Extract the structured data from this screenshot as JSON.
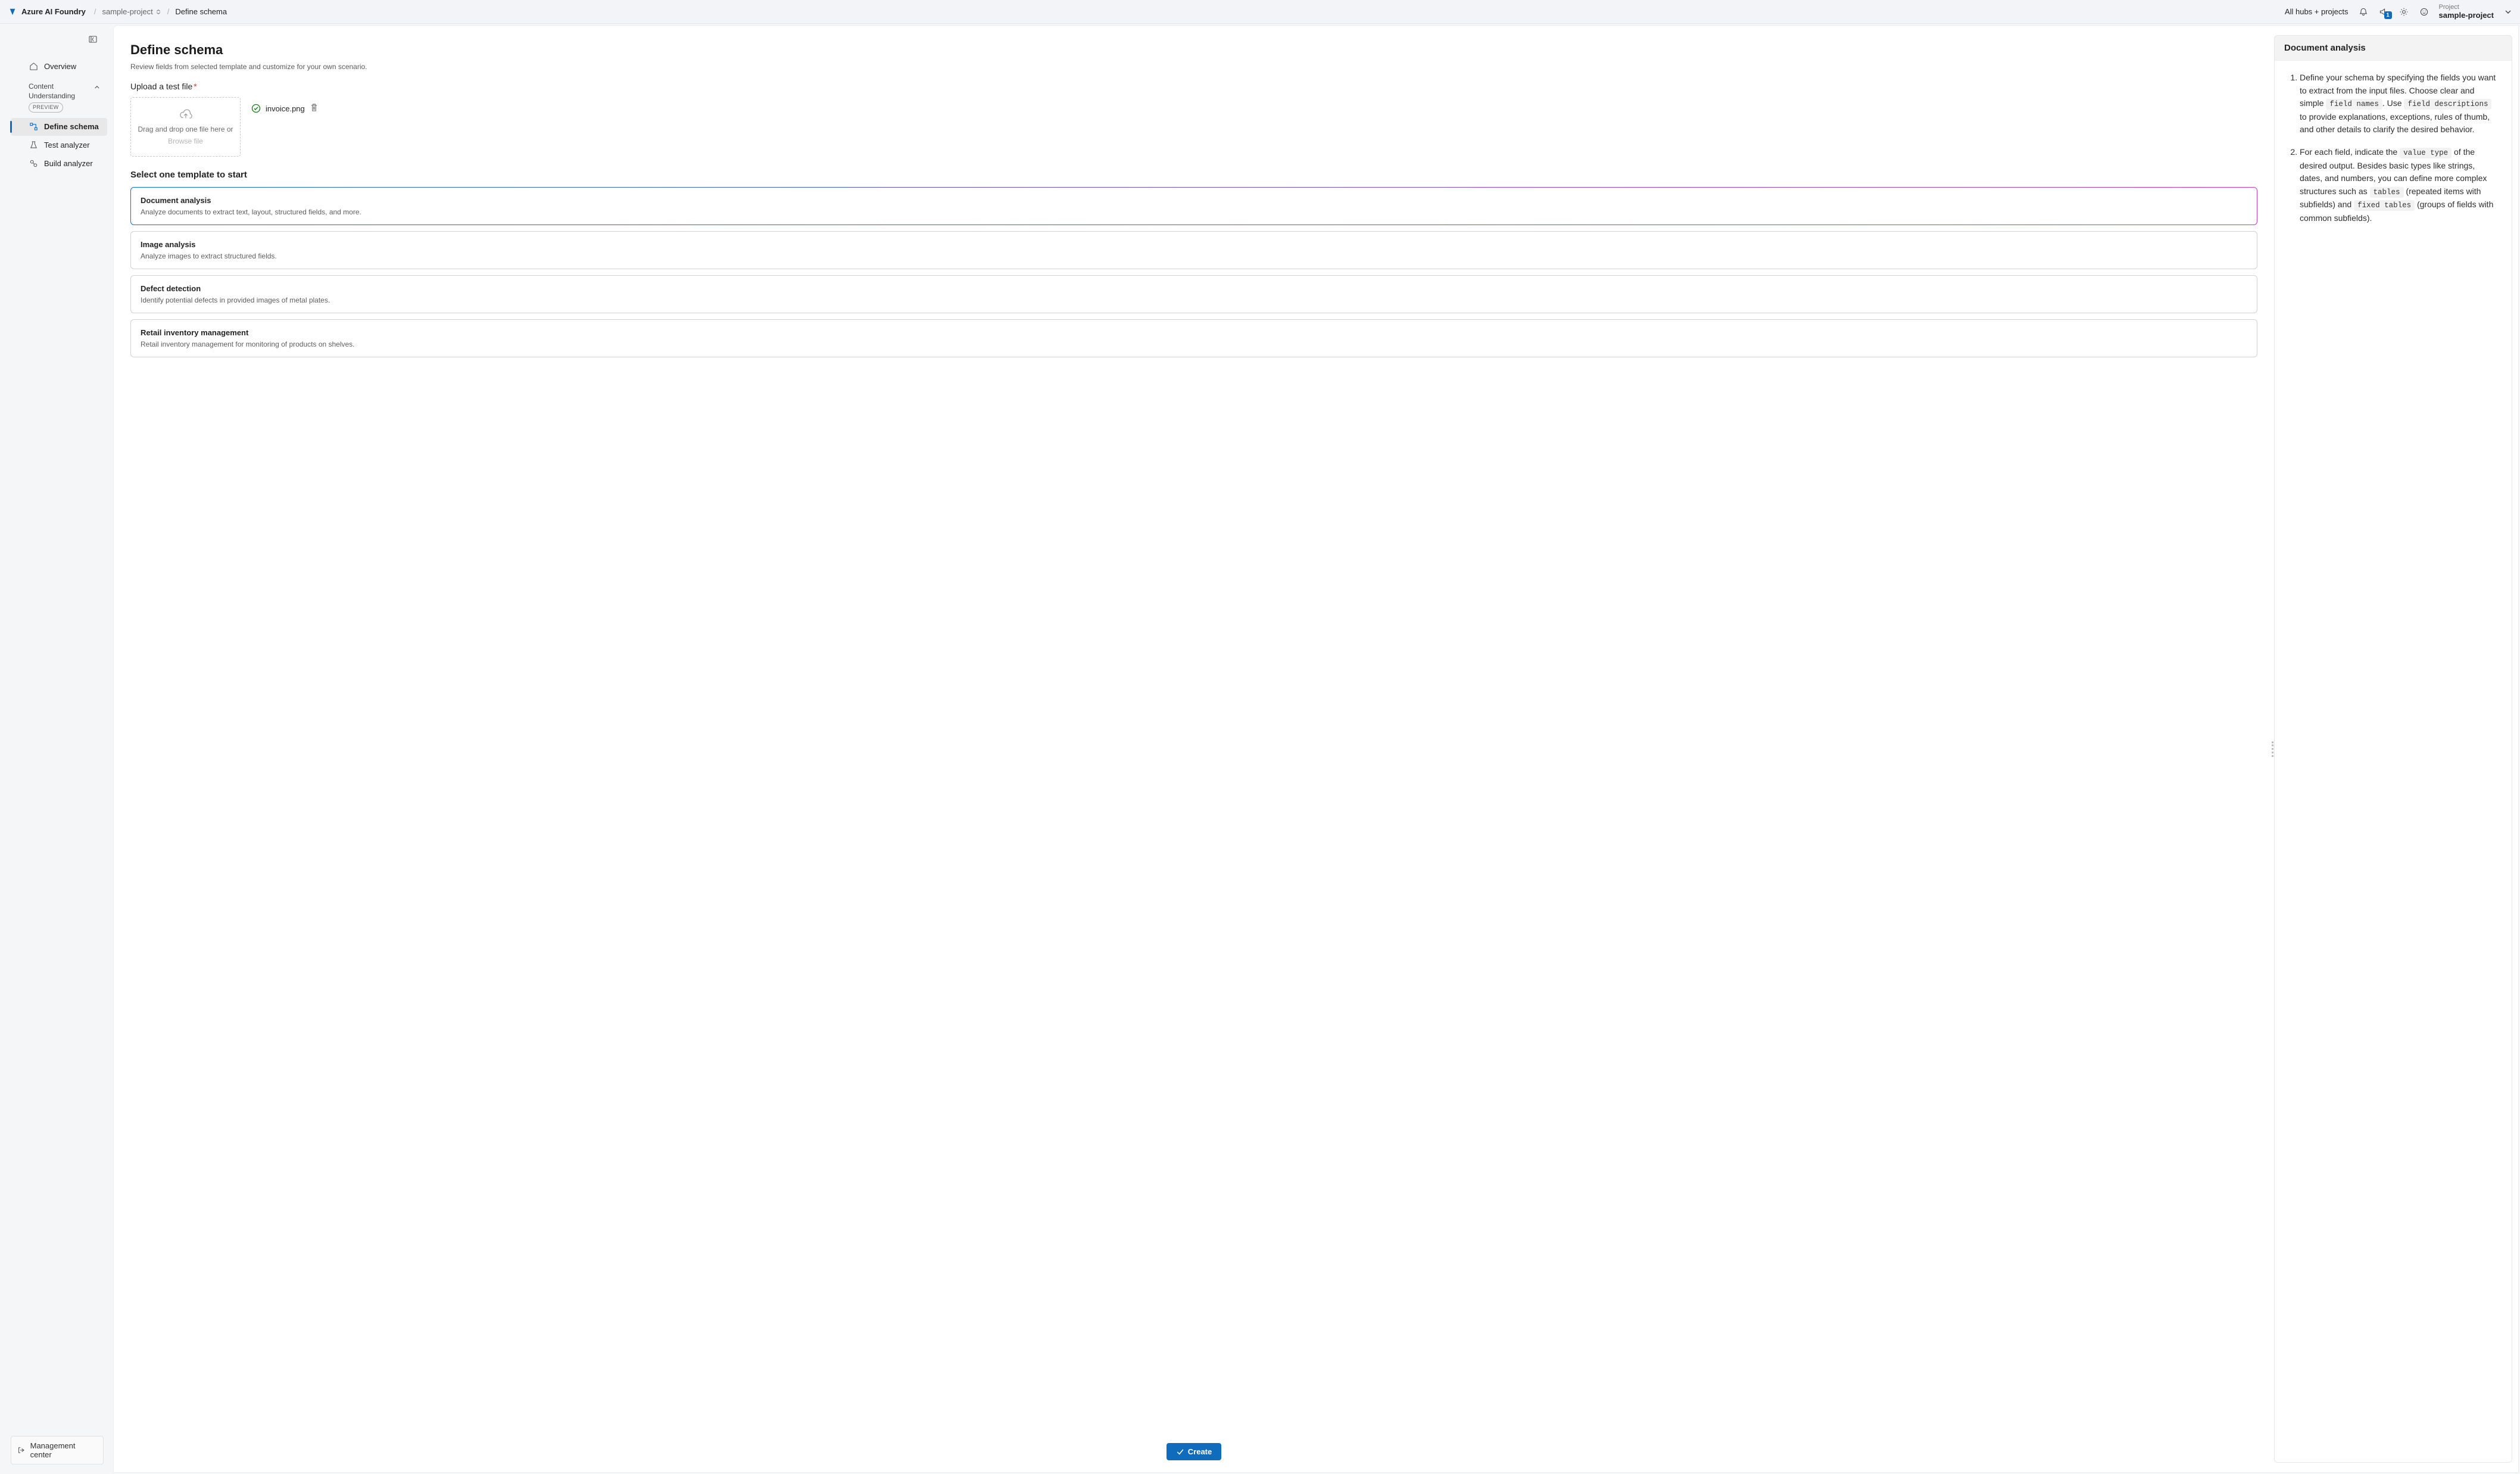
{
  "header": {
    "brand": "Azure AI Foundry",
    "breadcrumb_project": "sample-project",
    "breadcrumb_page": "Define schema",
    "hub_link": "All hubs + projects",
    "notification_count": "1",
    "project_label": "Project",
    "project_value": "sample-project"
  },
  "sidebar": {
    "overview": "Overview",
    "group_title": "Content Understanding",
    "preview_tag": "PREVIEW",
    "items": {
      "define_schema": "Define schema",
      "test_analyzer": "Test analyzer",
      "build_analyzer": "Build analyzer"
    },
    "management_center": "Management center"
  },
  "page": {
    "title": "Define schema",
    "subtitle": "Review fields from selected template and customize for your own scenario.",
    "upload_label": "Upload a test file",
    "dropzone_text": "Drag and drop one file here or",
    "dropzone_browse": "Browse file",
    "uploaded_file": "invoice.png",
    "section_heading": "Select one template to start",
    "templates": [
      {
        "title": "Document analysis",
        "desc": "Analyze documents to extract text, layout, structured fields, and more.",
        "selected": true
      },
      {
        "title": "Image analysis",
        "desc": "Analyze images to extract structured fields.",
        "selected": false
      },
      {
        "title": "Defect detection",
        "desc": "Identify potential defects in provided images of metal plates.",
        "selected": false
      },
      {
        "title": "Retail inventory management",
        "desc": "Retail inventory management for monitoring of products on shelves.",
        "selected": false
      }
    ],
    "create_button": "Create"
  },
  "info_panel": {
    "title": "Document analysis",
    "step1_a": "Define your schema by specifying the fields you want to extract from the input files. Choose clear and simple ",
    "step1_code1": "field names",
    "step1_b": ". Use ",
    "step1_code2": "field descriptions",
    "step1_c": " to provide explanations, exceptions, rules of thumb, and other details to clarify the desired behavior.",
    "step2_a": "For each field, indicate the ",
    "step2_code1": "value type",
    "step2_b": " of the desired output. Besides basic types like strings, dates, and numbers, you can define more complex structures such as ",
    "step2_code2": "tables",
    "step2_c": " (repeated items with subfields) and ",
    "step2_code3": "fixed tables",
    "step2_d": " (groups of fields with common subfields)."
  }
}
